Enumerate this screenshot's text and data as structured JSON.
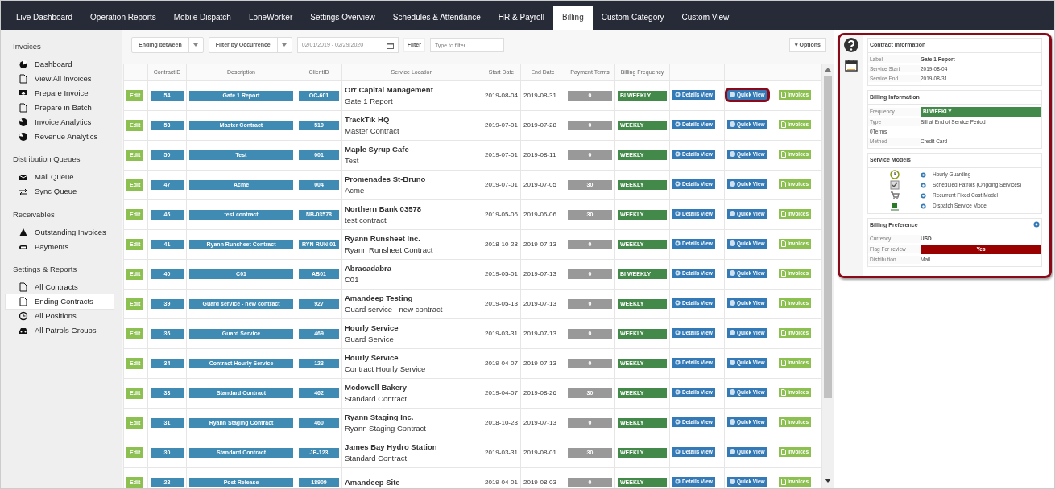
{
  "tabs": [
    {
      "label": "Live Dashboard",
      "selected": false
    },
    {
      "label": "Operation Reports",
      "selected": false
    },
    {
      "label": "Mobile Dispatch",
      "selected": false
    },
    {
      "label": "LoneWorker",
      "selected": false
    },
    {
      "label": "Settings Overview",
      "selected": false
    },
    {
      "label": "Schedules & Attendance",
      "selected": false
    },
    {
      "label": "HR & Payroll",
      "selected": false
    },
    {
      "label": "Billing",
      "selected": true
    },
    {
      "label": "Custom Category",
      "selected": false
    },
    {
      "label": "Custom View",
      "selected": false
    }
  ],
  "sidebar": {
    "sections": [
      {
        "title": "Invoices",
        "items": [
          {
            "label": "Dashboard",
            "selected": false
          },
          {
            "label": "View All Invoices",
            "selected": false
          },
          {
            "label": "Prepare Invoice",
            "selected": false
          },
          {
            "label": "Prepare in Batch",
            "selected": false
          },
          {
            "label": "Invoice Analytics",
            "selected": false
          },
          {
            "label": "Revenue Analytics",
            "selected": false
          }
        ]
      },
      {
        "title": "Distribution Queues",
        "items": [
          {
            "label": "Mail Queue",
            "selected": false
          },
          {
            "label": "Sync Queue",
            "selected": false
          }
        ]
      },
      {
        "title": "Receivables",
        "items": [
          {
            "label": "Outstanding Invoices",
            "selected": false
          },
          {
            "label": "Payments",
            "selected": false
          }
        ]
      },
      {
        "title": "Settings & Reports",
        "items": [
          {
            "label": "All Contracts",
            "selected": false
          },
          {
            "label": "Ending Contracts",
            "selected": true
          },
          {
            "label": "All Positions",
            "selected": false
          },
          {
            "label": "All Patrols Groups",
            "selected": false
          }
        ]
      }
    ]
  },
  "filters": {
    "range_mode": "Ending between",
    "occurrence": "Filter by Occurrence",
    "date_range": "02/01/2019 - 02/29/2020",
    "filter_label": "Filter",
    "search_placeholder": "Type to filter",
    "options": "▾ Options"
  },
  "table": {
    "columns": [
      "ContractID",
      "Description",
      "ClientID",
      "Service Location",
      "Start Date",
      "End Date",
      "Payment Terms",
      "Billing Frequency"
    ],
    "rows": [
      {
        "edit": "Edit",
        "id": "54",
        "description": "Gate 1 Report",
        "client": "OC-601",
        "location": "Orr Capital Management",
        "location_sub": "Gate 1 Report",
        "start": "2019-08-04",
        "end": "2019-08-31",
        "terms": "0",
        "frequency": "BI WEEKLY",
        "details": "Details View",
        "quick": "Quick View",
        "invoices": "Invoices",
        "highlighted": true
      },
      {
        "edit": "Edit",
        "id": "53",
        "description": "Master Contract",
        "client": "519",
        "location": "TrackTik HQ",
        "location_sub": "Master Contract",
        "start": "2019-07-01",
        "end": "2019-07-28",
        "terms": "0",
        "frequency": "WEEKLY",
        "details": "Details View",
        "quick": "Quick View",
        "invoices": "Invoices",
        "highlighted": false
      },
      {
        "edit": "Edit",
        "id": "50",
        "description": "Test",
        "client": "001",
        "location": "Maple Syrup Cafe",
        "location_sub": "Test",
        "start": "2019-07-01",
        "end": "2019-08-11",
        "terms": "0",
        "frequency": "WEEKLY",
        "details": "Details View",
        "quick": "Quick View",
        "invoices": "Invoices",
        "highlighted": false
      },
      {
        "edit": "Edit",
        "id": "47",
        "description": "Acme",
        "client": "004",
        "location": "Promenades St-Bruno",
        "location_sub": "Acme",
        "start": "2019-07-01",
        "end": "2019-07-05",
        "terms": "30",
        "frequency": "WEEKLY",
        "details": "Details View",
        "quick": "Quick View",
        "invoices": "Invoices",
        "highlighted": false
      },
      {
        "edit": "Edit",
        "id": "46",
        "description": "test contract",
        "client": "NB-03578",
        "location": "Northern Bank 03578",
        "location_sub": "test contract",
        "start": "2019-05-06",
        "end": "2019-06-06",
        "terms": "30",
        "frequency": "WEEKLY",
        "details": "Details View",
        "quick": "Quick View",
        "invoices": "Invoices",
        "highlighted": false
      },
      {
        "edit": "Edit",
        "id": "41",
        "description": "Ryann Runsheet Contract",
        "client": "RYN-RUN-01",
        "location": "Ryann Runsheet Inc.",
        "location_sub": "Ryann Runsheet Contract",
        "start": "2018-10-28",
        "end": "2019-07-13",
        "terms": "0",
        "frequency": "WEEKLY",
        "details": "Details View",
        "quick": "Quick View",
        "invoices": "Invoices",
        "highlighted": false
      },
      {
        "edit": "Edit",
        "id": "40",
        "description": "C01",
        "client": "AB01",
        "location": "Abracadabra",
        "location_sub": "C01",
        "start": "2019-05-01",
        "end": "2019-07-13",
        "terms": "0",
        "frequency": "BI WEEKLY",
        "details": "Details View",
        "quick": "Quick View",
        "invoices": "Invoices",
        "highlighted": false
      },
      {
        "edit": "Edit",
        "id": "39",
        "description": "Guard service - new contract",
        "client": "927",
        "location": "Amandeep Testing",
        "location_sub": "Guard service - new contract",
        "start": "2019-05-13",
        "end": "2019-07-13",
        "terms": "0",
        "frequency": "WEEKLY",
        "details": "Details View",
        "quick": "Quick View",
        "invoices": "Invoices",
        "highlighted": false
      },
      {
        "edit": "Edit",
        "id": "36",
        "description": "Guard Service",
        "client": "469",
        "location": "Hourly Service",
        "location_sub": "Guard Service",
        "start": "2019-03-31",
        "end": "2019-07-13",
        "terms": "0",
        "frequency": "WEEKLY",
        "details": "Details View",
        "quick": "Quick View",
        "invoices": "Invoices",
        "highlighted": false
      },
      {
        "edit": "Edit",
        "id": "34",
        "description": "Contract Hourly Service",
        "client": "123",
        "location": "Hourly Service",
        "location_sub": "Contract Hourly Service",
        "start": "2019-04-07",
        "end": "2019-07-13",
        "terms": "0",
        "frequency": "WEEKLY",
        "details": "Details View",
        "quick": "Quick View",
        "invoices": "Invoices",
        "highlighted": false
      },
      {
        "edit": "Edit",
        "id": "33",
        "description": "Standard Contract",
        "client": "462",
        "location": "Mcdowell Bakery",
        "location_sub": "Standard Contract",
        "start": "2019-04-07",
        "end": "2019-08-26",
        "terms": "30",
        "frequency": "WEEKLY",
        "details": "Details View",
        "quick": "Quick View",
        "invoices": "Invoices",
        "highlighted": false
      },
      {
        "edit": "Edit",
        "id": "31",
        "description": "Ryann Staging Contract",
        "client": "460",
        "location": "Ryann Staging Inc.",
        "location_sub": "Ryann Staging Contract",
        "start": "2018-10-28",
        "end": "2019-07-13",
        "terms": "0",
        "frequency": "WEEKLY",
        "details": "Details View",
        "quick": "Quick View",
        "invoices": "Invoices",
        "highlighted": false
      },
      {
        "edit": "Edit",
        "id": "30",
        "description": "Standard Contract",
        "client": "JB-123",
        "location": "James Bay Hydro Station",
        "location_sub": "Standard Contract",
        "start": "2019-03-31",
        "end": "2019-08-01",
        "terms": "30",
        "frequency": "WEEKLY",
        "details": "Details View",
        "quick": "Quick View",
        "invoices": "Invoices",
        "highlighted": false
      },
      {
        "edit": "Edit",
        "id": "28",
        "description": "Post Release",
        "client": "18909",
        "location": "Amandeep Site",
        "start": "2019-04-01",
        "end": "2019-08-03",
        "terms": "0",
        "frequency": "WEEKLY",
        "details": "Details View",
        "quick": "Quick View",
        "invoices": "Invoices",
        "highlighted": false
      }
    ]
  },
  "quick_view": {
    "sections": [
      {
        "title": "Contract Information",
        "kind": "fields",
        "fields": [
          {
            "label": "Label",
            "value": "Gate 1 Report",
            "kind": "bold"
          },
          {
            "label": "Service Start",
            "value": "2019-08-04",
            "kind": "text"
          },
          {
            "label": "Service End",
            "value": "2019-08-31",
            "kind": "text"
          }
        ]
      },
      {
        "title": "Billing Information",
        "kind": "fields",
        "fields": [
          {
            "label": "Frequency",
            "value": "BI WEEKLY",
            "kind": "badge",
            "color": "#43894a"
          },
          {
            "label": "Type",
            "value": "Bill at End of Service Period",
            "kind": "text"
          },
          {
            "label": "0Terms",
            "kind": "note"
          },
          {
            "label": "Method",
            "value": "Credit Card",
            "kind": "text"
          }
        ]
      },
      {
        "title": "Service Models",
        "kind": "models",
        "models": [
          "Hourly Guarding",
          "Scheduled Patrols (Ongoing Services)",
          "Recurrent Fixed Cost Model",
          "Dispatch Service Model"
        ]
      },
      {
        "title": "Billing Preference",
        "kind": "fields",
        "gear": true,
        "fields": [
          {
            "label": "Currency",
            "value": "USD",
            "kind": "bold"
          },
          {
            "label": "Flag For review",
            "value": "Yes",
            "kind": "badge",
            "color": "#990000"
          },
          {
            "label": "Distribution",
            "value": "Mail",
            "kind": "text"
          }
        ]
      }
    ]
  }
}
